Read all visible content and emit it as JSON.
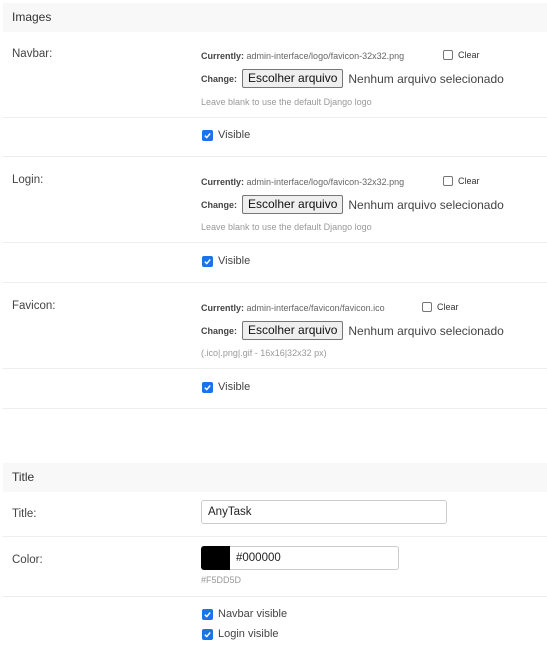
{
  "images_section": {
    "title": "Images",
    "navbar": {
      "label": "Navbar:",
      "currently_label": "Currently:",
      "currently_value": "admin-interface/logo/favicon-32x32.png",
      "clear_label": "Clear",
      "change_label": "Change:",
      "file_button": "Escolher arquivo",
      "file_status": "Nenhum arquivo selecionado",
      "help": "Leave blank to use the default Django logo",
      "visible_label": "Visible",
      "visible_checked": true
    },
    "login": {
      "label": "Login:",
      "currently_label": "Currently:",
      "currently_value": "admin-interface/logo/favicon-32x32.png",
      "clear_label": "Clear",
      "change_label": "Change:",
      "file_button": "Escolher arquivo",
      "file_status": "Nenhum arquivo selecionado",
      "help": "Leave blank to use the default Django logo",
      "visible_label": "Visible",
      "visible_checked": true
    },
    "favicon": {
      "label": "Favicon:",
      "currently_label": "Currently:",
      "currently_value": "admin-interface/favicon/favicon.ico",
      "clear_label": "Clear",
      "change_label": "Change:",
      "file_button": "Escolher arquivo",
      "file_status": "Nenhum arquivo selecionado",
      "help": "(.ico|.png|.gif - 16x16|32x32 px)",
      "visible_label": "Visible",
      "visible_checked": true
    }
  },
  "title_section": {
    "title": "Title",
    "title_label": "Title:",
    "title_value": "AnyTask",
    "color_label": "Color:",
    "color_value": "#000000",
    "color_swatch": "#000000",
    "color_help": "#F5DD5D",
    "navbar_visible_label": "Navbar visible",
    "navbar_visible_checked": true,
    "login_visible_label": "Login visible",
    "login_visible_checked": true
  },
  "colors": {
    "checkbox_accent": "#1a73e8",
    "section_header_bg": "#f8f8f8"
  }
}
